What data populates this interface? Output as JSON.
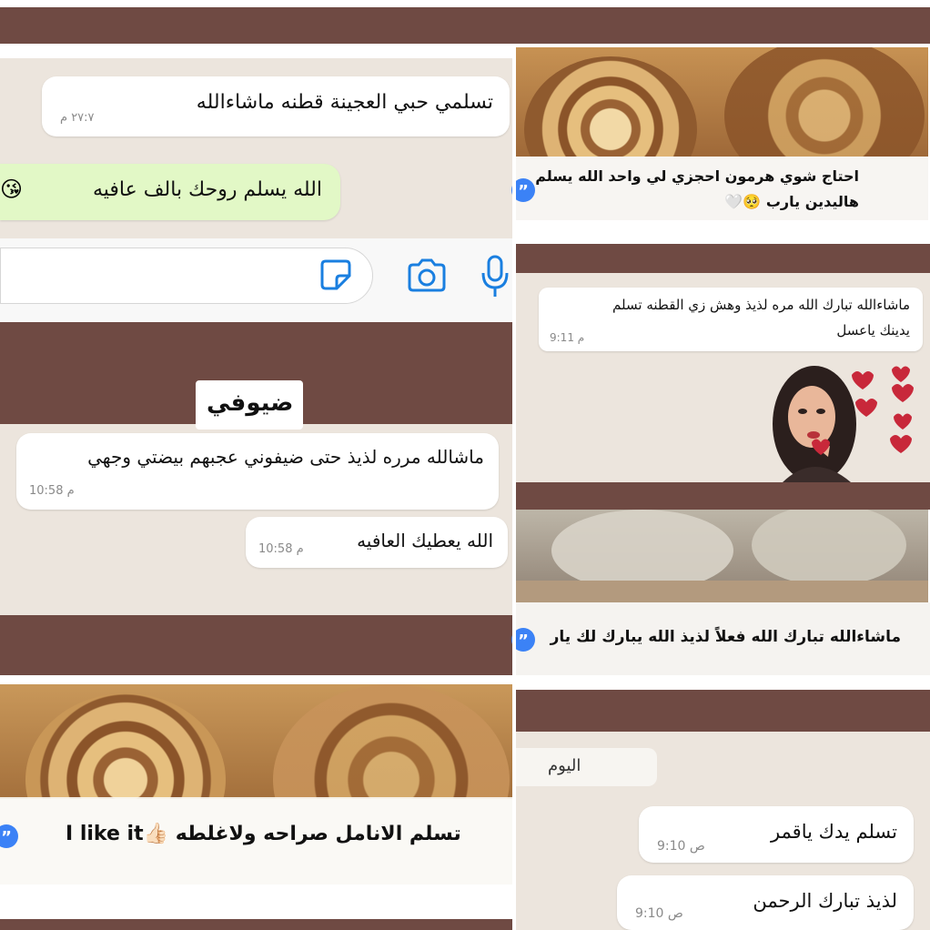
{
  "left": {
    "msg1": {
      "text": "تسلمي حبي العجينة قطنه ماشاءالله",
      "time": "٢٧:٧ م"
    },
    "msg2": {
      "text": "الله يسلم روحك بالف عافيه",
      "emoji": "😘"
    },
    "guest_label": "ضيوفي",
    "msg3": {
      "text": "ماشالله مرره لذيذ حتى ضيفوني عجبهم بيضتي وجهي",
      "time": "10:58 م"
    },
    "msg4": {
      "text": "الله يعطيك العافيه",
      "time": "10:58 م"
    },
    "msg5": {
      "text": "تسلم الانامل صراحه ولاغلطه",
      "emoji": "👍🏻",
      "suffix": "I like it"
    }
  },
  "right": {
    "msg1": {
      "line1": "احتاج شوي هرمون احجزي لي واحد الله يسلم",
      "line2": "هاليدين يارب",
      "emoji": "🥺🤍"
    },
    "msg2": {
      "line1": "ماشاءالله تبارك الله مره لذيذ وهش زي القطنه تسلم",
      "line2": "يدينك ياعسل",
      "time": "9:11 م"
    },
    "msg3": {
      "text": "ماشاءالله تبارك الله  فعلاً لذيذ الله يبارك لك يار"
    },
    "day_label": "اليوم",
    "msg4": {
      "text": "تسلم يدك ياقمر",
      "time": "9:10 ص"
    },
    "msg5": {
      "text": "لذيذ تبارك الرحمن",
      "time": "9:10 ص"
    }
  },
  "icons": [
    "sticker-icon",
    "camera-icon",
    "microphone-icon",
    "quote-icon",
    "hearts-sticker"
  ],
  "colors": {
    "bar": "#6f4a43",
    "chat_bg": "#ece5dd",
    "accent": "#1a7fe0",
    "green_bubble": "#e2f8c6"
  }
}
